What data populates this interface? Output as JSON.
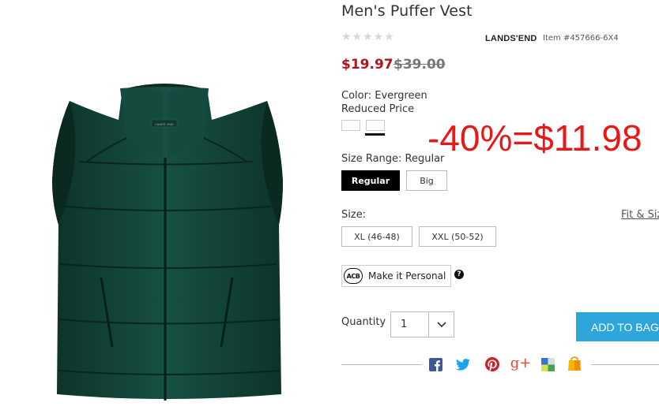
{
  "product": {
    "title": "Men's Puffer Vest",
    "stars": "★★★★★",
    "brand": "LANDS'END",
    "item_number": "Item #457666-6X4",
    "price": "$19.97",
    "original_price": "$39.00",
    "tag_label": "LANDS' END"
  },
  "color": {
    "label": "Color: Evergreen",
    "reduced": "Reduced Price"
  },
  "annotation": "-40%=$11.98",
  "size_range": {
    "label": "Size Range: Regular",
    "options": [
      "Regular",
      "Big"
    ],
    "selected": "Regular"
  },
  "size": {
    "label": "Size:",
    "fit_link": "Fit & Size",
    "options": [
      "XL (46-48)",
      "XXL (50-52)"
    ]
  },
  "personalize": {
    "logo": "ACB",
    "label": "Make it Personal",
    "help": "?"
  },
  "quantity": {
    "label": "Quantity",
    "value": "1"
  },
  "cart": {
    "add_label": "ADD TO BAG"
  },
  "share": {
    "icons": [
      "facebook-icon",
      "twitter-icon",
      "pinterest-icon",
      "google-plus-icon",
      "delicious-icon",
      "shopping-bag-icon"
    ]
  },
  "colors": {
    "price_red": "#b5121b",
    "annotation_red": "#e81818",
    "vest_green": "#123e33",
    "button_blue": "#2ea5db"
  }
}
